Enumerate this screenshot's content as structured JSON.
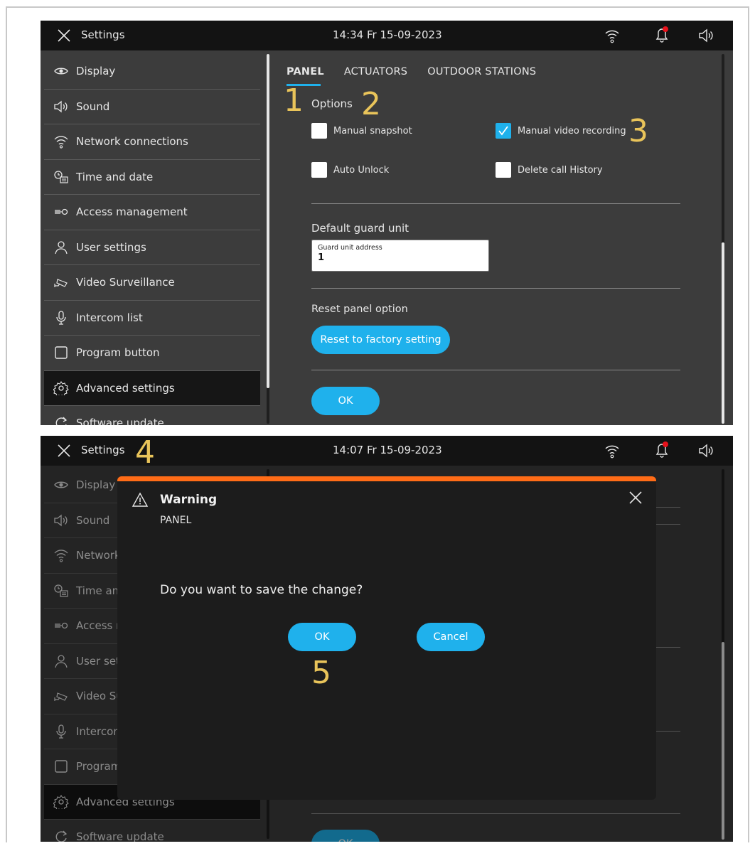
{
  "colors": {
    "accent": "#1fb1ec",
    "dialog_bar": "#ff6c17",
    "annotation": "#e9c45a",
    "notification_dot": "#e8121c"
  },
  "screen1": {
    "topbar": {
      "title": "Settings",
      "datetime": "14:34  Fr 15-09-2023",
      "icons": [
        "close-icon",
        "wifi-icon",
        "bell-icon",
        "speaker-icon"
      ]
    },
    "sidebar": {
      "items": [
        {
          "label": "Display",
          "icon": "eye-icon"
        },
        {
          "label": "Sound",
          "icon": "speaker-icon"
        },
        {
          "label": "Network connections",
          "icon": "wifi-icon"
        },
        {
          "label": "Time and date",
          "icon": "clock-calendar-icon"
        },
        {
          "label": "Access  management",
          "icon": "key-icon"
        },
        {
          "label": "User settings",
          "icon": "user-icon"
        },
        {
          "label": "Video Surveillance",
          "icon": "camera-icon"
        },
        {
          "label": "Intercom list",
          "icon": "microphone-icon"
        },
        {
          "label": "Program button",
          "icon": "square-icon"
        },
        {
          "label": "Advanced settings",
          "icon": "gear-icon",
          "active": true
        },
        {
          "label": "Software update",
          "icon": "refresh-icon"
        }
      ]
    },
    "tabs": [
      "PANEL",
      "ACTUATORS",
      "OUTDOOR STATIONS"
    ],
    "active_tab": "PANEL",
    "options_title": "Options",
    "options": [
      {
        "label": "Manual snapshot",
        "checked": false
      },
      {
        "label": "Manual video recording",
        "checked": true
      },
      {
        "label": "Auto Unlock",
        "checked": false
      },
      {
        "label": "Delete call History",
        "checked": false
      }
    ],
    "guard": {
      "label": "Default guard unit",
      "field_placeholder": "Guard unit address",
      "field_value": "1"
    },
    "reset": {
      "label": "Reset panel option",
      "button": "Reset to factory setting"
    },
    "ok_button": "OK"
  },
  "screen2": {
    "topbar": {
      "title": "Settings",
      "datetime": "14:07  Fr 15-09-2023"
    },
    "sidebar": {
      "items": [
        {
          "label": "Display",
          "icon": "eye-icon"
        },
        {
          "label": "Sound",
          "icon": "speaker-icon"
        },
        {
          "label": "Network connections",
          "icon": "wifi-icon"
        },
        {
          "label": "Time and date",
          "icon": "clock-calendar-icon"
        },
        {
          "label": "Access  management",
          "icon": "key-icon"
        },
        {
          "label": "User settings",
          "icon": "user-icon"
        },
        {
          "label": "Video Surveillance",
          "icon": "camera-icon"
        },
        {
          "label": "Intercom list",
          "icon": "microphone-icon"
        },
        {
          "label": "Program button",
          "icon": "square-icon"
        },
        {
          "label": "Advanced settings",
          "icon": "gear-icon",
          "active": true
        },
        {
          "label": "Software update",
          "icon": "refresh-icon"
        }
      ]
    },
    "dialog": {
      "title": "Warning",
      "subtitle": "PANEL",
      "message": "Do you want to save the change?",
      "ok": "OK",
      "cancel": "Cancel"
    },
    "ok_button": "OK"
  },
  "annotations": [
    "1",
    "2",
    "3",
    "4",
    "5"
  ]
}
